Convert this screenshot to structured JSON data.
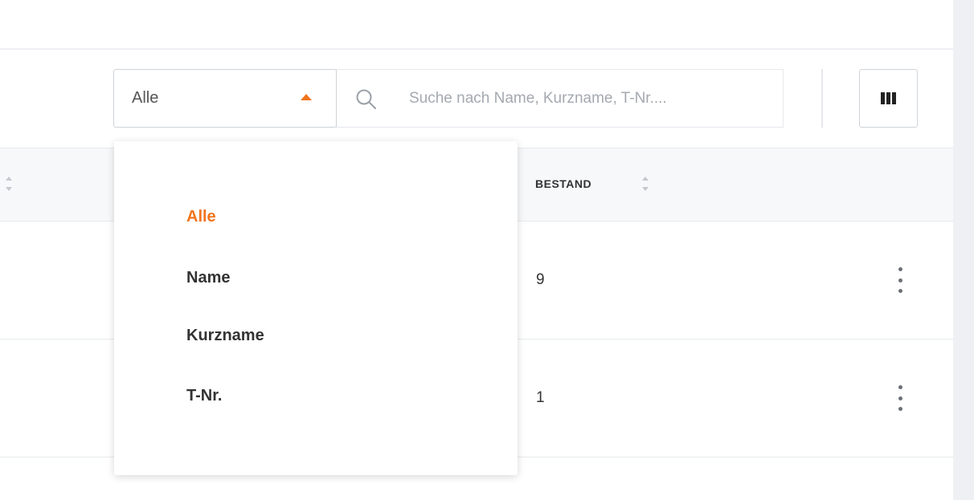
{
  "filter": {
    "selected": "Alle",
    "options": [
      "Alle",
      "Name",
      "Kurzname",
      "T-Nr."
    ],
    "accent_color": "#f2741d"
  },
  "search": {
    "placeholder": "Suche nach Name, Kurzname, T-Nr....",
    "value": ""
  },
  "toolbar": {
    "columns_icon": "columns-icon"
  },
  "table": {
    "columns": [
      "BESTAND"
    ],
    "rows": [
      {
        "bestand": "9"
      },
      {
        "bestand": "1"
      }
    ]
  },
  "icons": {
    "search": "search-icon",
    "sort": "sort-icon",
    "more": "more-vertical-icon",
    "caret": "caret-up-icon"
  }
}
